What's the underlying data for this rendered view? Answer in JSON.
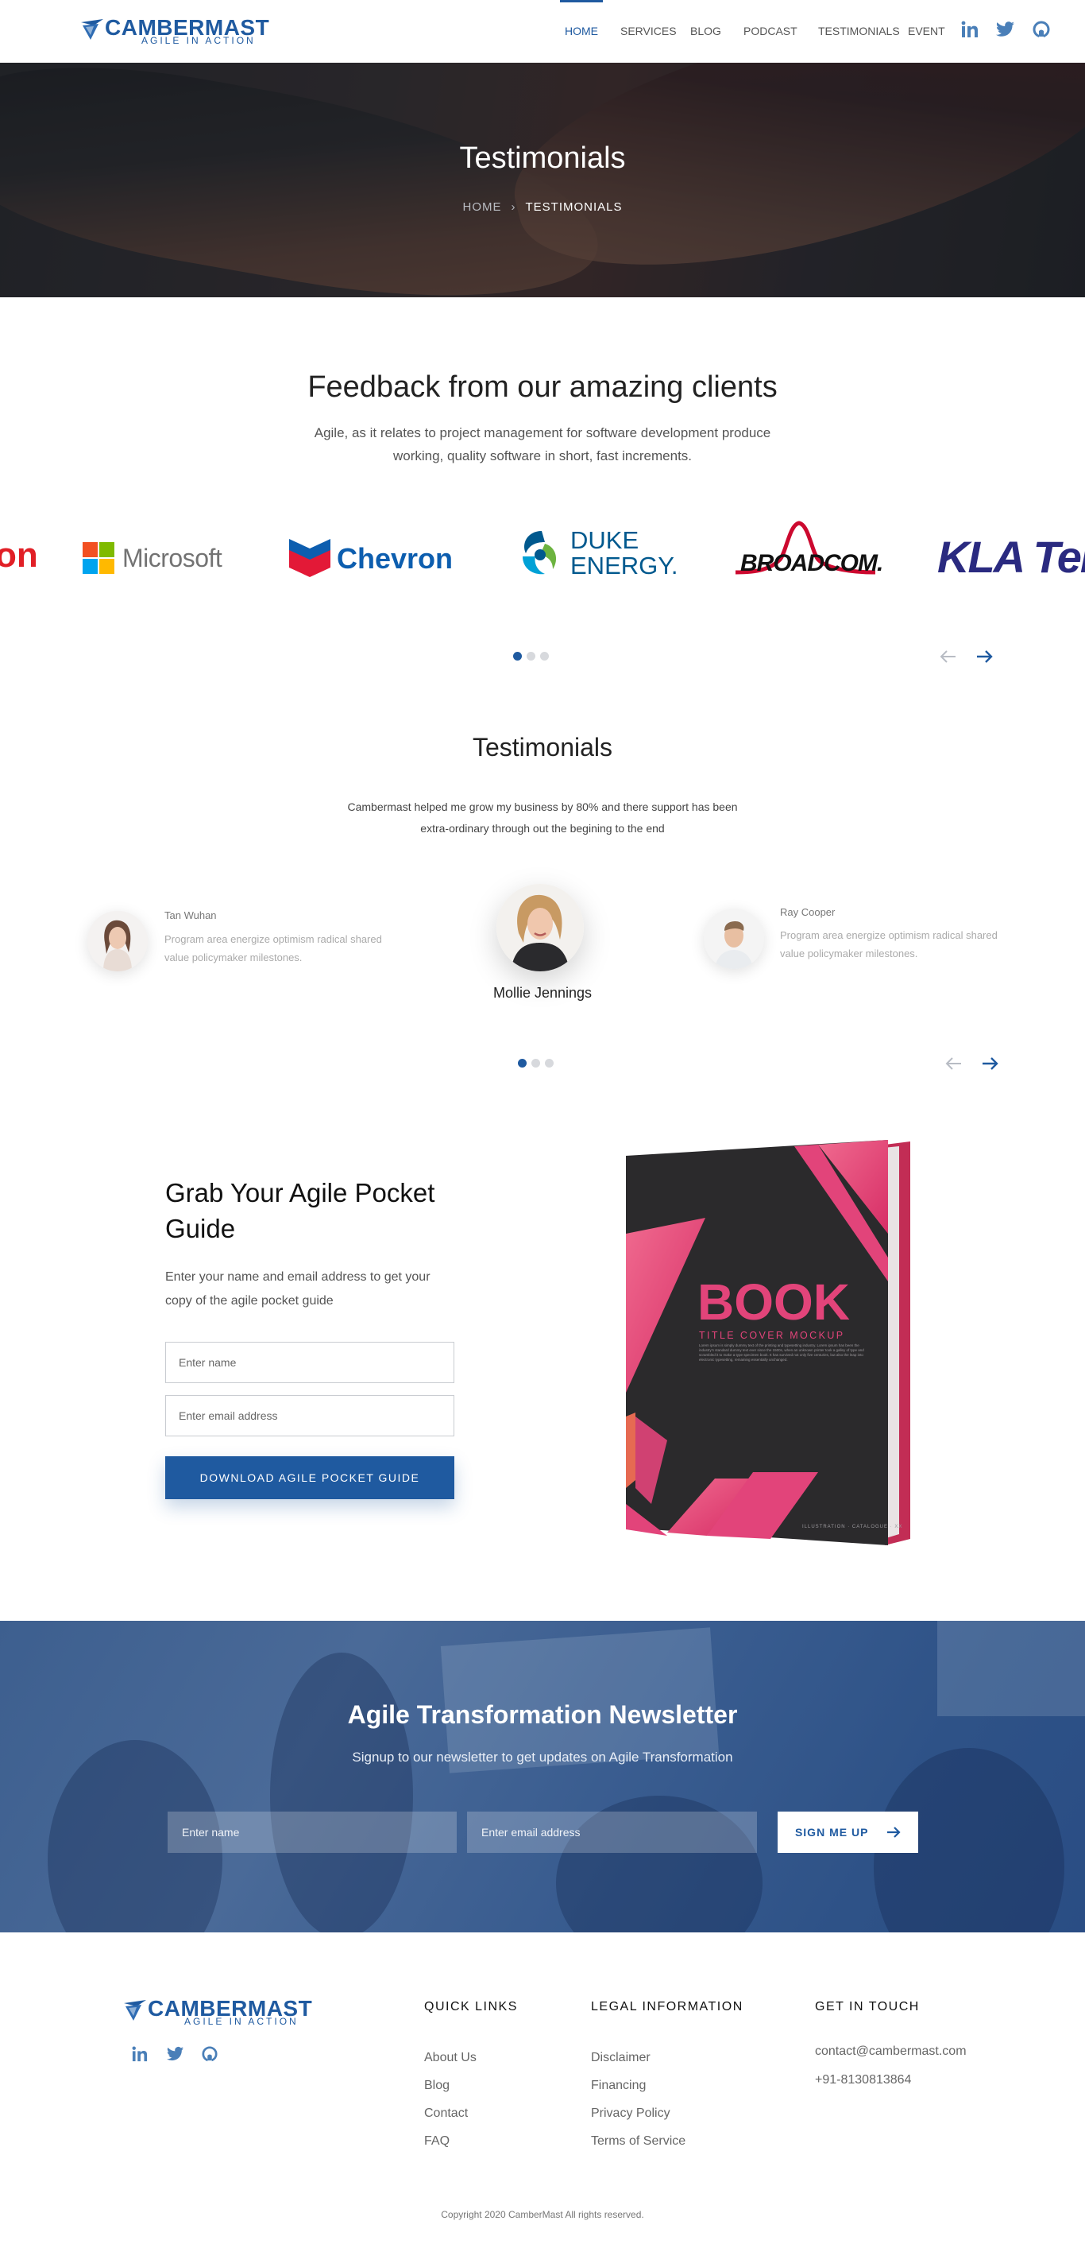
{
  "brand": {
    "name": "CAMBERMAST",
    "tagline": "AGILE IN ACTION",
    "color": "#1f5aa0"
  },
  "nav": {
    "items": [
      {
        "label": "HOME",
        "active": true
      },
      {
        "label": "SERVICES"
      },
      {
        "label": "BLOG"
      },
      {
        "label": "PODCAST"
      },
      {
        "label": "TESTIMONIALS"
      },
      {
        "label": "EVENT"
      }
    ],
    "social_icons": [
      "linkedin-icon",
      "twitter-icon",
      "github-icon"
    ]
  },
  "hero": {
    "title": "Testimonials",
    "breadcrumb": {
      "home": "HOME",
      "separator": "›",
      "current": "TESTIMONIALS"
    }
  },
  "feedback": {
    "title": "Feedback from our amazing clients",
    "description": "Agile, as it relates to project management for software development produce working, quality software in short, fast increments.",
    "logos": [
      {
        "name": "on",
        "color": "#e11f26"
      },
      {
        "name": "Microsoft",
        "color": "#737373"
      },
      {
        "name": "Chevron",
        "color": "#0d5eaf"
      },
      {
        "name": "DUKE ENERGY.",
        "line1": "DUKE",
        "line2": "ENERGY.",
        "color": "#00598e"
      },
      {
        "name": "BROADCOM.",
        "color": "#cc092f"
      },
      {
        "name": "KLA Tencor",
        "color": "#2a2a80"
      }
    ],
    "carousel": {
      "pages": 3,
      "active": 0
    }
  },
  "testimonials": {
    "title": "Testimonials",
    "quote": "Cambermast helped me grow my business by 80% and there support has been extra-ordinary through out the begining to the end",
    "people": [
      {
        "name": "Tan Wuhan",
        "text": "Program area energize optimism radical shared value policymaker milestones."
      },
      {
        "name": "Mollie Jennings"
      },
      {
        "name": "Ray Cooper",
        "text": "Program area energize optimism radical shared value policymaker milestones."
      }
    ],
    "carousel": {
      "pages": 3,
      "active": 0
    }
  },
  "guide": {
    "title": "Grab Your Agile Pocket Guide",
    "description": "Enter your name and email address to get your copy of the agile pocket guide",
    "name_placeholder": "Enter name",
    "email_placeholder": "Enter email address",
    "button": "DOWNLOAD AGILE POCKET GUIDE",
    "book": {
      "title": "BOOK",
      "subtitle": "TITLE COVER MOCKUP",
      "body": "Lorem ipsum is simply dummy text of the printing and typesetting industry. Lorem ipsum has been the industry's standard dummy text ever since the 1500s, when an unknown printer took a galley of type and scrambled it to make a type specimen book. It has survived not only five centuries, but also the leap into electronic typesetting, remaining essentially unchanged.",
      "footer": "ILLUSTRATION · CATALOGUE · XX",
      "colors": {
        "cover": "#2b2a2c",
        "accent": "#e2447a",
        "spine": "#c22d55"
      }
    }
  },
  "newsletter": {
    "title": "Agile Transformation Newsletter",
    "description": "Signup to our newsletter to get updates on Agile Transformation",
    "name_placeholder": "Enter name",
    "email_placeholder": "Enter email address",
    "button": "SIGN ME UP"
  },
  "footer": {
    "quick_links": {
      "title": "QUICK LINKS",
      "items": [
        "About Us",
        "Blog",
        "Contact",
        "FAQ"
      ]
    },
    "legal": {
      "title": "LEGAL INFORMATION",
      "items": [
        "Disclaimer",
        "Financing",
        "Privacy Policy",
        "Terms of Service"
      ]
    },
    "contact": {
      "title": "GET IN TOUCH",
      "email": "contact@cambermast.com",
      "phone": "+91-8130813864"
    },
    "social_icons": [
      "linkedin-icon",
      "twitter-icon",
      "github-icon"
    ],
    "copyright": "Copyright 2020 CamberMast All rights reserved."
  }
}
